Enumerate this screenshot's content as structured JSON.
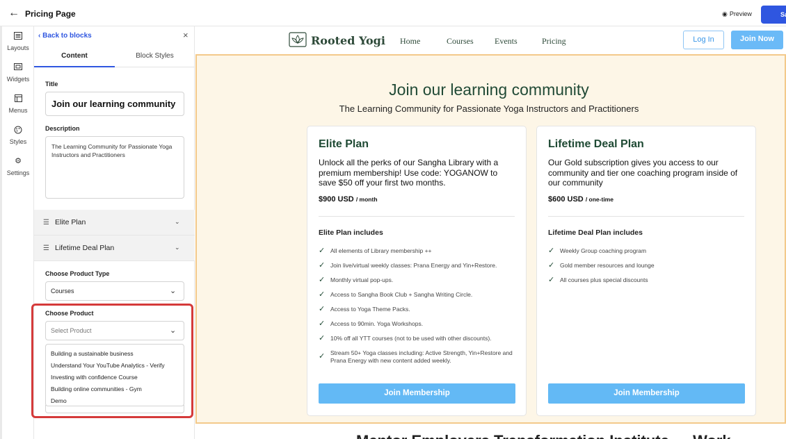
{
  "topbar": {
    "page_title": "Pricing Page",
    "preview_label": "Preview",
    "save_label": "Sa"
  },
  "rail": {
    "items": [
      {
        "label": "Layouts",
        "icon": "layouts-icon"
      },
      {
        "label": "Widgets",
        "icon": "widgets-icon"
      },
      {
        "label": "Menus",
        "icon": "menus-icon"
      },
      {
        "label": "Styles",
        "icon": "palette-icon"
      },
      {
        "label": "Settings",
        "icon": "gear-icon"
      }
    ]
  },
  "panel": {
    "back_label": "Back to blocks",
    "tabs": [
      {
        "label": "Content",
        "active": true
      },
      {
        "label": "Block Styles",
        "active": false
      }
    ],
    "title_label": "Title",
    "title_value": "Join our learning community",
    "description_label": "Description",
    "description_value": "The Learning Community for Passionate Yoga Instructors and Practitioners",
    "accordions": [
      {
        "label": "Elite Plan"
      },
      {
        "label": "Lifetime Deal Plan"
      }
    ],
    "product_type_label": "Choose Product Type",
    "product_type_value": "Courses",
    "product_label": "Choose Product",
    "product_placeholder": "Select Product",
    "product_options": [
      "Building a sustainable business",
      "Understand Your YouTube Analytics - Verify",
      "Investing with confidence Course",
      "Building online communities - Gym",
      "Demo"
    ],
    "annotation_color": "#d53a3a"
  },
  "site": {
    "logo_text": "Rooted Yogi",
    "nav_links": [
      "Home",
      "Courses",
      "Events",
      "Pricing"
    ],
    "login_label": "Log In",
    "join_label": "Join Now"
  },
  "pricing": {
    "title": "Join our learning community",
    "subtitle": "The Learning Community for Passionate Yoga Instructors and Practitioners",
    "plans": [
      {
        "name": "Elite Plan",
        "description": "Unlock all the perks of our Sangha Library with a premium membership! Use code: YOGANOW to save $50 off your first two months.",
        "price": "$900 USD",
        "period": "/ month",
        "includes_title": "Elite Plan includes",
        "features": [
          "All elements of Library membership ++",
          "Join live/virtual weekly classes: Prana Energy and Yin+Restore.",
          "Monthly virtual pop-ups.",
          "Access to Sangha Book Club + Sangha Writing Circle.",
          "Access to Yoga Theme Packs.",
          "Access to 90min. Yoga Workshops.",
          "10% off all YTT courses (not to be used with other discounts).",
          "Stream 50+ Yoga classes including: Active Strength, Yin+Restore and Prana Energy with new content added weekly."
        ],
        "button_label": "Join Membership"
      },
      {
        "name": "Lifetime Deal Plan",
        "description": "Our Gold subscription gives you access to our community and tier one coaching program inside of our community",
        "price": "$600 USD",
        "period": "/ one-time",
        "includes_title": "Lifetime Deal Plan includes",
        "features": [
          "Weekly Group coaching program",
          "Gold member resources and lounge",
          "All courses plus special discounts"
        ],
        "button_label": "Join Membership"
      }
    ],
    "bottom_peek": "Mentor Employers Transformation Institute — Work"
  },
  "colors": {
    "brand_blue": "#2f56e0",
    "accent_sky": "#63b9f5",
    "forest_green": "#1f4a34",
    "section_bg": "#fdf6e7",
    "section_border": "#f3c98a"
  }
}
